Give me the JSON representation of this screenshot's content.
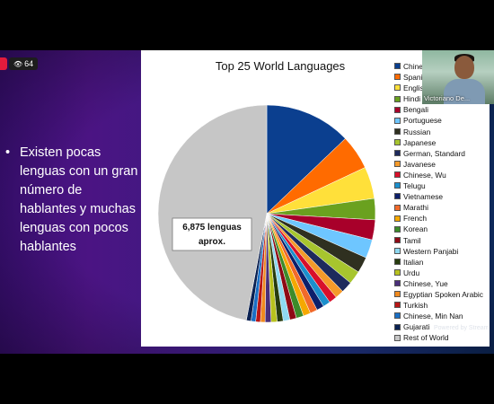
{
  "live": {
    "viewers": "64"
  },
  "camera": {
    "name": "Victoriano De..."
  },
  "slide": {
    "bullet": "Existen pocas lenguas con un gran número de hablantes y muchas  lenguas con pocos hablantes",
    "chart_title": "Top 25 World Languages",
    "callout_line1": "6,875 lenguas",
    "callout_line2": "aprox."
  },
  "chart_data": {
    "type": "pie",
    "title": "Top 25 World Languages",
    "categories": [
      "Chinese",
      "Spanish",
      "English",
      "Hindi",
      "Bengali",
      "Portuguese",
      "Russian",
      "Japanese",
      "German, Standard",
      "Javanese",
      "Chinese, Wu",
      "Telugu",
      "Vietnamese",
      "Marathi",
      "French",
      "Korean",
      "Tamil",
      "Western Panjabi",
      "Italian",
      "Urdu",
      "Chinese, Yue",
      "Egyptian Spoken Arabic",
      "Turkish",
      "Chinese, Min Nan",
      "Gujarati",
      "Rest of World"
    ],
    "legend_labels": [
      "Chines",
      "Spanis",
      "English",
      "Hindi",
      "Bengali",
      "Portuguese",
      "Russian",
      "Japanese",
      "German, Standard",
      "Javanese",
      "Chinese, Wu",
      "Telugu",
      "Vietnamese",
      "Marathi",
      "French",
      "Korean",
      "Tamil",
      "Western Panjabi",
      "Italian",
      "Urdu",
      "Chinese, Yue",
      "Egyptian Spoken Arabic",
      "Turkish",
      "Chinese, Min Nan",
      "Gujarati",
      "Rest of World"
    ],
    "values": [
      13.0,
      5.2,
      4.8,
      3.2,
      3.0,
      2.8,
      2.4,
      2.0,
      1.7,
      1.3,
      1.2,
      1.1,
      1.1,
      1.1,
      1.1,
      1.1,
      1.0,
      1.0,
      0.9,
      0.9,
      0.9,
      0.7,
      0.7,
      0.7,
      0.7,
      47.5
    ],
    "colors": [
      "#0b3f8f",
      "#ff6b00",
      "#ffe03a",
      "#6aa11f",
      "#a8002a",
      "#6ec6ff",
      "#2f3020",
      "#a7c52e",
      "#1d2a5c",
      "#f59a2a",
      "#d8102b",
      "#1c8fcc",
      "#0d1f6b",
      "#f26a2a",
      "#f5a800",
      "#3d8b2a",
      "#8e0a16",
      "#8ed8f0",
      "#273c0f",
      "#b8c21e",
      "#4a2f7a",
      "#f08a1e",
      "#b81616",
      "#1a6fc4",
      "#0a2152",
      "#c6c6c6"
    ],
    "legend": "right"
  },
  "footer": {
    "powered": "Powered by Stream"
  }
}
